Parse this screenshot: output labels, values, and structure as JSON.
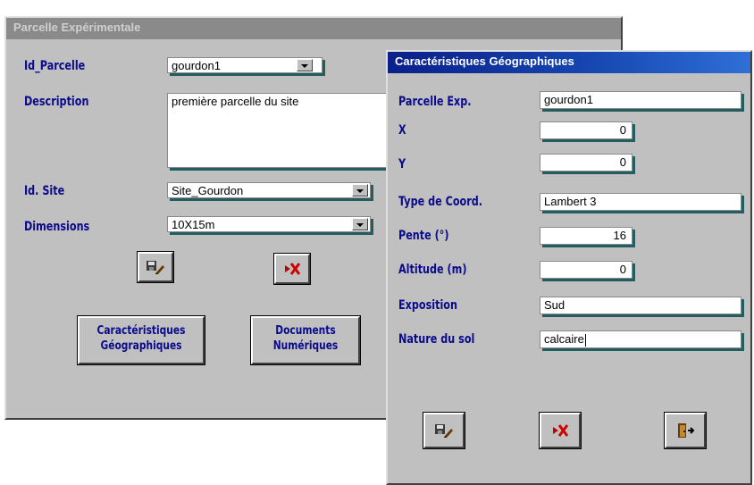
{
  "back_window": {
    "title": "Parcelle Expérimentale",
    "labels": {
      "id_parcelle": "Id_Parcelle",
      "description": "Description",
      "id_site": "Id. Site",
      "dimensions": "Dimensions"
    },
    "fields": {
      "id_parcelle": "gourdon1",
      "description": "première parcelle du site",
      "id_site": "Site_Gourdon",
      "dimensions": "10X15m"
    },
    "buttons": {
      "carac_line1": "Caractéristiques",
      "carac_line2": "Géographiques",
      "docs_line1": "Documents",
      "docs_line2": "Numériques"
    }
  },
  "front_window": {
    "title": "Caractéristiques Géographiques",
    "labels": {
      "parcelle_exp": "Parcelle Exp.",
      "x": "X",
      "y": "Y",
      "type_coord": "Type de Coord.",
      "pente": "Pente (°)",
      "altitude": "Altitude (m)",
      "exposition": "Exposition",
      "nature_sol": "Nature du sol"
    },
    "fields": {
      "parcelle_exp": "gourdon1",
      "x": "0",
      "y": "0",
      "type_coord": "Lambert 3",
      "pente": "16",
      "altitude": "0",
      "exposition": "Sud",
      "nature_sol": "calcaire"
    }
  },
  "icons": {
    "save": "save-edit-icon",
    "delete": "delete-x-icon",
    "exit": "exit-door-icon"
  },
  "colors": {
    "label": "#0a0a8c",
    "window_bg": "#c0c0c0",
    "field_shadow": "#235d5d",
    "active_title": "#0a1f8a",
    "inactive_title": "#8a8a8a"
  }
}
